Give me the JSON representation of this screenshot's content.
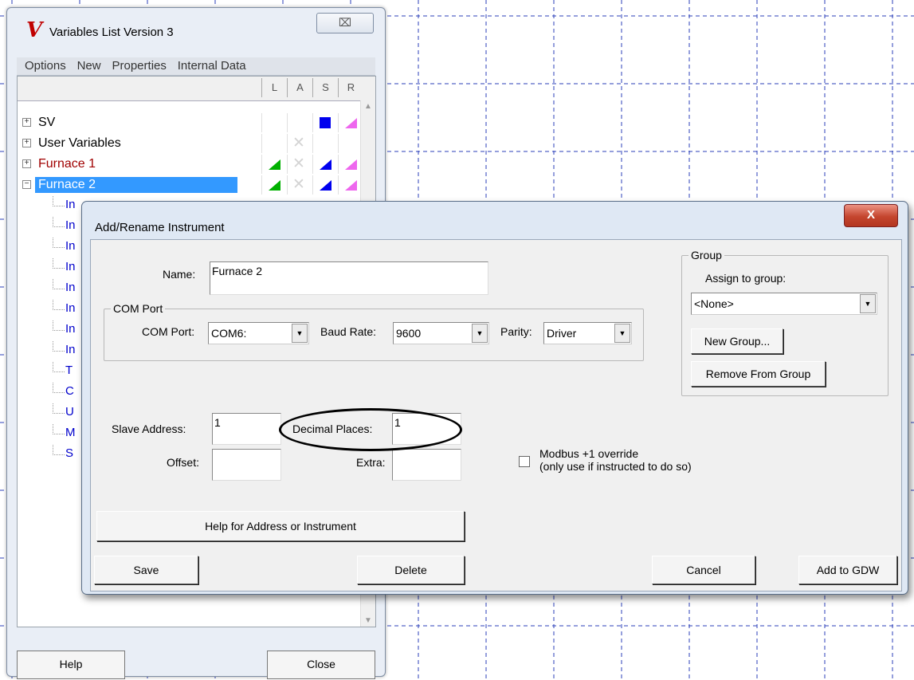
{
  "variables_window": {
    "logo": "V",
    "title": "Variables List Version 3",
    "close_glyph": "⌧",
    "menu": [
      "Options",
      "New",
      "Properties",
      "Internal Data"
    ],
    "columns": [
      "L",
      "A",
      "S",
      "R"
    ],
    "tree": [
      {
        "expander": "+",
        "label": "SV",
        "color": "#000000",
        "selected": false
      },
      {
        "expander": "+",
        "label": "User Variables",
        "color": "#000000",
        "selected": false
      },
      {
        "expander": "+",
        "label": "Furnace 1",
        "color": "#a00000",
        "selected": false
      },
      {
        "expander": "−",
        "label": "Furnace 2",
        "color": "#ffffff",
        "selected": true
      }
    ],
    "partial_children": [
      "In",
      "In",
      "In",
      "In",
      "In",
      "In",
      "In",
      "In",
      "T",
      "C",
      "U",
      "M",
      "S"
    ],
    "help_label": "Help",
    "close_label": "Close",
    "colors": {
      "selection": "#3399ff",
      "logging": "#00b000",
      "sample": "#0000ee",
      "report": "#ee66ee",
      "furnace1": "#a00000",
      "children": "#0000cc"
    }
  },
  "dialog": {
    "title": "Add/Rename Instrument",
    "close_glyph": "X",
    "name_label": "Name:",
    "name_value": "Furnace 2",
    "com_port_group": "COM Port",
    "com_port_label": "COM Port:",
    "com_port_value": "COM6:",
    "baud_label": "Baud Rate:",
    "baud_value": "9600",
    "parity_label": "Parity:",
    "parity_value": "Driver",
    "group_legend": "Group",
    "assign_label": "Assign to group:",
    "group_value": "<None>",
    "new_group_label": "New Group...",
    "remove_group_label": "Remove From Group",
    "slave_label": "Slave Address:",
    "slave_value": "1",
    "decimal_label": "Decimal Places:",
    "decimal_value": "1",
    "offset_label": "Offset:",
    "offset_value": "",
    "extra_label": "Extra:",
    "extra_value": "",
    "modbus_line1": "Modbus +1 override",
    "modbus_line2": "(only use if instructed to do so)",
    "modbus_checked": false,
    "help_button": "Help for Address or  Instrument",
    "save_button": "Save",
    "delete_button": "Delete",
    "cancel_button": "Cancel",
    "add_gdw_button": "Add to GDW"
  }
}
